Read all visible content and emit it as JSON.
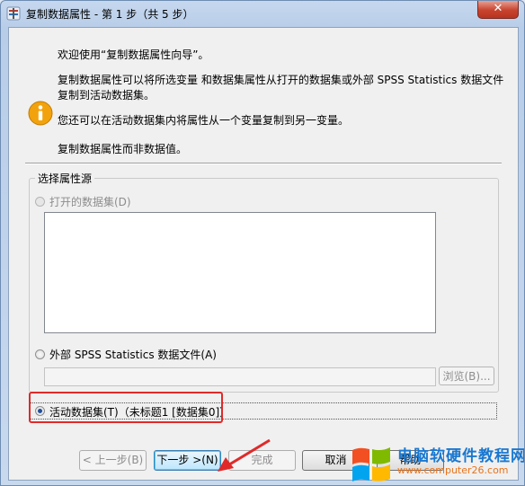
{
  "window": {
    "title": "复制数据属性 - 第 1 步（共 5 步）",
    "close_label": "✕"
  },
  "intro": {
    "line1": "欢迎使用“复制数据属性向导”。",
    "line2": "复制数据属性可以将所选变量 和数据集属性从打开的数据集或外部 SPSS Statistics 数据文件复制到活动数据集。",
    "line3": "您还可以在活动数据集内将属性从一个变量复制到另一变量。",
    "line4": "复制数据属性而非数据值。"
  },
  "source_group": {
    "legend": "选择属性源",
    "open_dataset_label": "打开的数据集(D)",
    "external_file_label": "外部 SPSS Statistics 数据文件(A)",
    "file_path_value": "",
    "browse_label": "浏览(B)...",
    "active_dataset_label": "活动数据集(T)（未标题1 [数据集0]）",
    "selected": "active_dataset"
  },
  "buttons": {
    "back": "< 上一步(B)",
    "next": "下一步 >(N)",
    "finish": "完成",
    "cancel": "取消",
    "help": "帮助"
  },
  "watermark": {
    "title": "电脑软硬件教程网",
    "url": "www.computer26.com"
  },
  "colors": {
    "highlight": "#e02a2a",
    "info_icon": "#f2a20c",
    "watermark_blue": "#1a78d0"
  }
}
